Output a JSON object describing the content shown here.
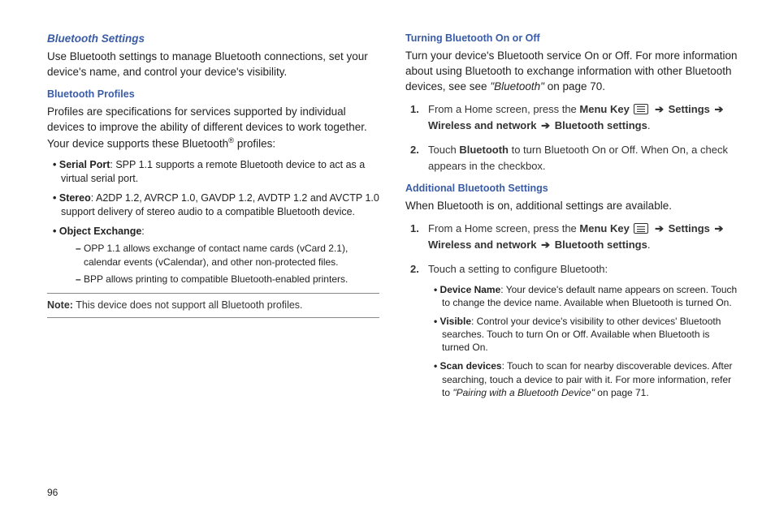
{
  "left": {
    "heading": "Bluetooth Settings",
    "intro": "Use Bluetooth settings to manage Bluetooth connections, set your device's name, and control your device's visibility.",
    "sub1_heading": "Bluetooth Profiles",
    "profiles_intro_a": "Profiles are specifications for services supported by individual devices to improve the ability of different devices to work together. Your device supports these Bluetooth",
    "profiles_intro_b": " profiles:",
    "b1_label": "Serial Port",
    "b1_text": ": SPP 1.1 supports a remote Bluetooth device to act as a virtual serial port.",
    "b2_label": " Stereo",
    "b2_text": ": A2DP 1.2, AVRCP 1.0, GAVDP 1.2, AVDTP 1.2 and AVCTP 1.0 support delivery of stereo audio to a compatible Bluetooth device.",
    "b3_label": "Object Exchange",
    "b3_text": ":",
    "b3_sub1": "OPP 1.1 allows exchange of contact name cards (vCard 2.1), calendar events (vCalendar), and other non-protected files.",
    "b3_sub2": "BPP allows printing to compatible Bluetooth-enabled printers.",
    "note_label": "Note:",
    "note_text": " This device does not support all Bluetooth profiles."
  },
  "right": {
    "sec1_heading": "Turning Bluetooth On or Off",
    "sec1_intro_a": "Turn your device's Bluetooth service On or Off. For more information about using Bluetooth to exchange information with other Bluetooth devices, see see ",
    "sec1_intro_ref": "\"Bluetooth\"",
    "sec1_intro_b": " on page 70.",
    "step1_a": "From a Home screen, press the ",
    "menu_key": "Menu Key",
    "settings": "Settings",
    "wireless": "Wireless and network",
    "bt_settings": "Bluetooth settings",
    "step2_a": "Touch ",
    "step2_bt": "Bluetooth",
    "step2_b": " to turn Bluetooth On or Off. When On, a check appears in the checkbox.",
    "sec2_heading": "Additional Bluetooth Settings",
    "sec2_intro": "When Bluetooth is on, additional settings are available.",
    "step2_config": "Touch a setting to configure Bluetooth:",
    "opt1_label": "Device Name",
    "opt1_text": ": Your device's default name appears on screen. Touch to change the device name. Available when Bluetooth is turned On.",
    "opt2_label": "Visible",
    "opt2_text": ": Control your device's visibility to other devices' Bluetooth searches. Touch to turn On or Off. Available when Bluetooth is turned On.",
    "opt3_label": "Scan devices",
    "opt3_text_a": ": Touch to scan for nearby discoverable devices. After searching, touch a device to pair with it. For more information, refer to ",
    "opt3_ref": "\"Pairing with a Bluetooth Device\" ",
    "opt3_text_b": " on page 71."
  },
  "page": "96",
  "arrow": "➔",
  "reg": "®"
}
